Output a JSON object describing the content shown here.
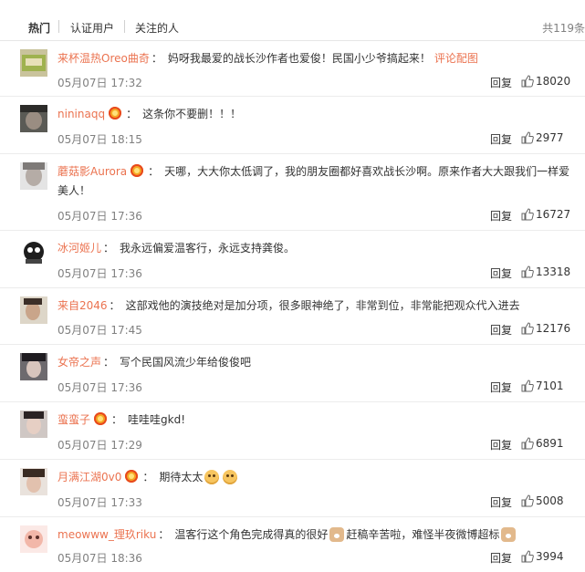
{
  "tabs": [
    {
      "label": "热门",
      "active": true
    },
    {
      "label": "认证用户",
      "active": false
    },
    {
      "label": "关注的人",
      "active": false
    }
  ],
  "total_label": "共119条",
  "reply_label": "回复",
  "colors": {
    "username": "#eb7350",
    "meta": "#808080",
    "vip_badge": "#f5a623"
  },
  "comments": [
    {
      "user": "来杯温热Oreo曲奇",
      "vip": false,
      "text": "妈呀我最爱的战长沙作者也爱俊！民国小少爷搞起来！",
      "link": "评论配图",
      "time": "05月07日 17:32",
      "likes": "18020",
      "avatar_icon": "food-photo-avatar"
    },
    {
      "user": "nininaqq",
      "vip": true,
      "text": "这条你不要删！！！",
      "time": "05月07日 18:15",
      "likes": "2977",
      "avatar_icon": "portrait-avatar"
    },
    {
      "user": "蘑菇影Aurora",
      "vip": true,
      "text": "天哪，大大你太低调了，我的朋友圈都好喜欢战长沙啊。原来作者大大跟我们一样爱美人！",
      "time": "05月07日 17:36",
      "likes": "16727",
      "avatar_icon": "portrait-avatar"
    },
    {
      "user": "冰河姬儿",
      "vip": false,
      "text": "我永远偏爱温客行，永远支持龚俊。",
      "time": "05月07日 17:36",
      "likes": "13318",
      "avatar_icon": "cartoon-avatar"
    },
    {
      "user": "来自2046",
      "vip": false,
      "text": "这部戏他的演技绝对是加分项，很多眼神绝了，非常到位，非常能把观众代入进去",
      "time": "05月07日 17:45",
      "likes": "12176",
      "avatar_icon": "portrait-avatar"
    },
    {
      "user": "女帝之声",
      "vip": false,
      "text": "写个民国风流少年给俊俊吧",
      "time": "05月07日 17:36",
      "likes": "7101",
      "avatar_icon": "portrait-avatar"
    },
    {
      "user": "蛮蛮子",
      "vip": true,
      "text": "哇哇哇gkd!",
      "time": "05月07日 17:29",
      "likes": "6891",
      "avatar_icon": "portrait-avatar"
    },
    {
      "user": "月满江湖0v0",
      "vip": true,
      "text": "期待太太",
      "time": "05月07日 17:33",
      "likes": "5008",
      "avatar_icon": "portrait-avatar",
      "emojis": [
        "laughing-emoji",
        "laughing-emoji"
      ]
    },
    {
      "user": "meowww_理玖riku",
      "vip": false,
      "text_parts": [
        "温客行这个角色完成得真的很好",
        "赶稿辛苦啦，难怪半夜微博超标"
      ],
      "time": "05月07日 18:36",
      "likes": "3994",
      "avatar_icon": "cartoon-avatar",
      "emojis": [
        "doge-emoji",
        "doge-emoji"
      ]
    }
  ]
}
